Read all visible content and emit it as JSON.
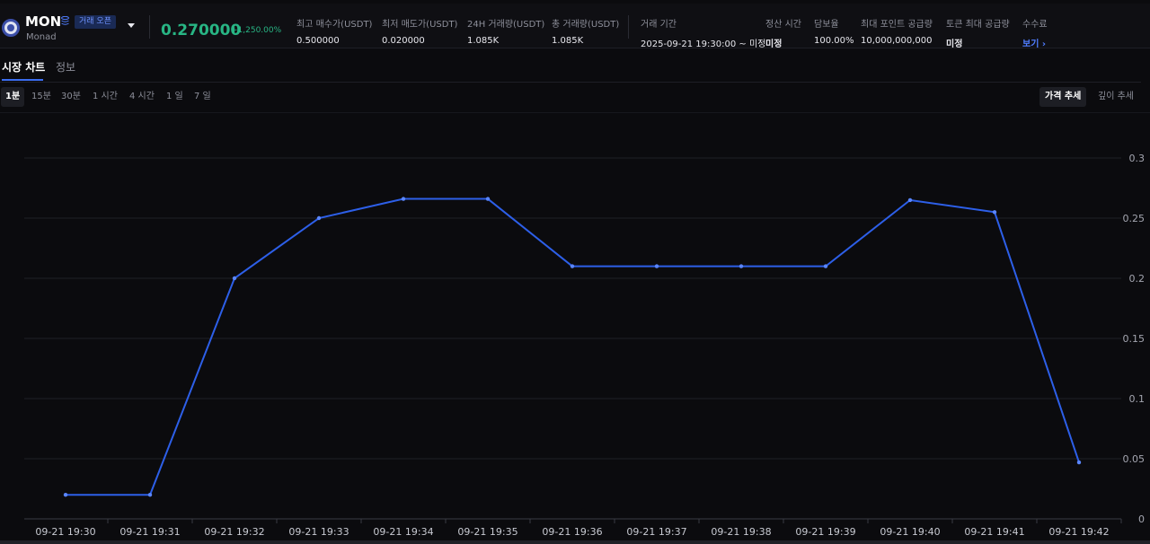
{
  "header": {
    "symbol": "MON",
    "name": "Monad",
    "status": "거래 오픈",
    "price": "0.270000",
    "change": "+1,250.00%",
    "stats": [
      {
        "label": "최고 매수가(USDT)",
        "value": "0.500000"
      },
      {
        "label": "최저 매도가(USDT)",
        "value": "0.020000"
      },
      {
        "label": "24H 거래량(USDT)",
        "value": "1.085K"
      },
      {
        "label": "총 거래량(USDT)",
        "value": "1.085K"
      },
      {
        "label": "거래 기간",
        "value": "2025-09-21 19:30:00 ~ 미정"
      },
      {
        "label": "정산 시간",
        "value": "미정"
      },
      {
        "label": "담보율",
        "value": "100.00%"
      },
      {
        "label": "최대 포인트 공급량",
        "value": "10,000,000,000"
      },
      {
        "label": "토큰 최대 공급량",
        "value": "미정"
      },
      {
        "label": "수수료",
        "value": "보기"
      }
    ]
  },
  "tabs": [
    "시장 차트",
    "정보"
  ],
  "intervals": [
    "1분",
    "15분",
    "30분",
    "1 시간",
    "4 시간",
    "1 일",
    "7 일"
  ],
  "view_modes": [
    "가격 추세",
    "깊이 추세"
  ],
  "colors": {
    "accent": "#3b6df0",
    "up": "#28b584",
    "line": "#2d5fe8"
  },
  "chart_data": {
    "type": "line",
    "categories": [
      "09-21 19:30",
      "09-21 19:31",
      "09-21 19:32",
      "09-21 19:33",
      "09-21 19:34",
      "09-21 19:35",
      "09-21 19:36",
      "09-21 19:37",
      "09-21 19:38",
      "09-21 19:39",
      "09-21 19:40",
      "09-21 19:41",
      "09-21 19:42"
    ],
    "values": [
      0.02,
      0.02,
      0.2,
      0.25,
      0.266,
      0.266,
      0.21,
      0.21,
      0.21,
      0.21,
      0.265,
      0.255,
      0.047
    ],
    "yticks": [
      "0",
      "0.05",
      "0.1",
      "0.15",
      "0.2",
      "0.25",
      "0.3"
    ],
    "ylim": [
      0,
      0.3
    ],
    "grid": true,
    "axis_position": "right"
  }
}
